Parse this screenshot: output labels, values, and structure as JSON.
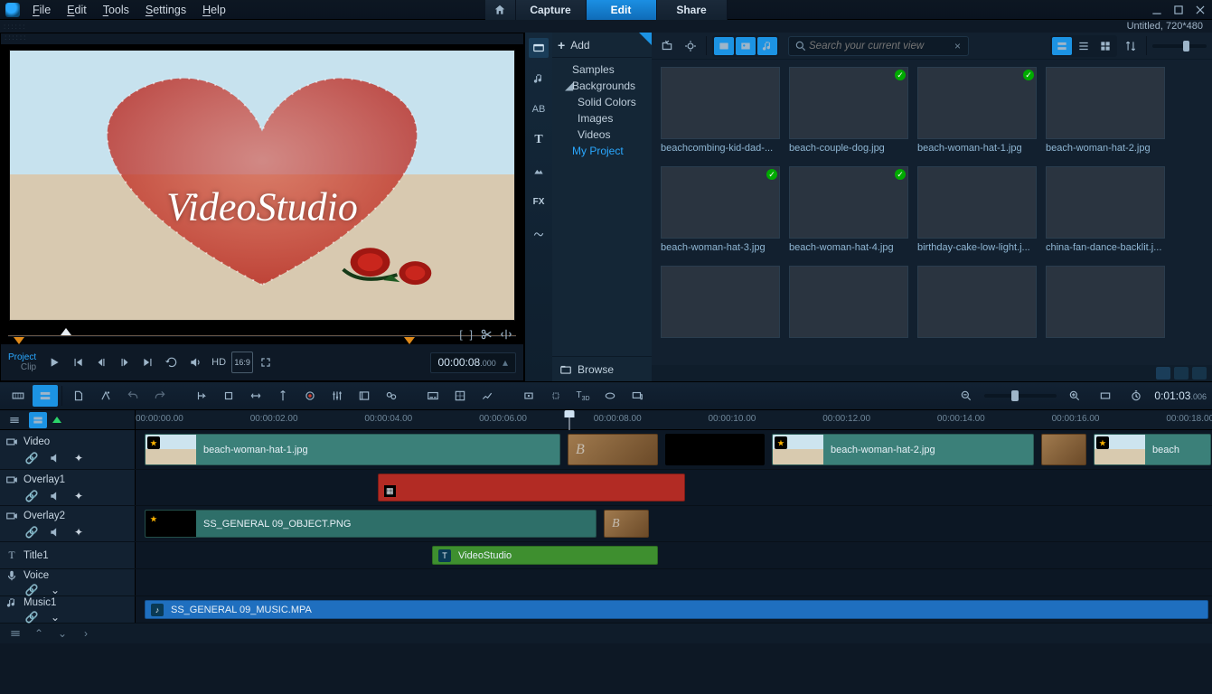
{
  "menus": {
    "file": "File",
    "edit": "Edit",
    "tools": "Tools",
    "settings": "Settings",
    "help": "Help"
  },
  "tabs": {
    "capture": "Capture",
    "edit": "Edit",
    "share": "Share"
  },
  "doc_title": "Untitled, 720*480",
  "preview": {
    "mode_project": "Project",
    "mode_clip": "Clip",
    "hd": "HD",
    "aspect": "16:9",
    "timecode": "00:00:08",
    "timecode_frames": ".000",
    "overlay_text": "VideoStudio"
  },
  "library": {
    "add": "Add",
    "tree": {
      "samples": "Samples",
      "backgrounds": "Backgrounds",
      "solid": "Solid Colors",
      "images": "Images",
      "videos": "Videos",
      "myproject": "My Project"
    },
    "browse": "Browse",
    "search_placeholder": "Search your current view",
    "items": [
      {
        "name": "beachcombing-kid-dad-...",
        "cls": "tg-beach",
        "chk": false
      },
      {
        "name": "beach-couple-dog.jpg",
        "cls": "tg-couple",
        "chk": true
      },
      {
        "name": "beach-woman-hat-1.jpg",
        "cls": "tg-hat",
        "chk": true
      },
      {
        "name": "beach-woman-hat-2.jpg",
        "cls": "tg-hat",
        "chk": false
      },
      {
        "name": "beach-woman-hat-3.jpg",
        "cls": "tg-hat",
        "chk": true
      },
      {
        "name": "beach-woman-hat-4.jpg",
        "cls": "tg-hat",
        "chk": true
      },
      {
        "name": "birthday-cake-low-light.j...",
        "cls": "tg-cake",
        "chk": false
      },
      {
        "name": "china-fan-dance-backlit.j...",
        "cls": "tg-fan",
        "chk": false
      },
      {
        "name": "",
        "cls": "tg-bus",
        "chk": false
      },
      {
        "name": "",
        "cls": "tg-selfie",
        "chk": false
      },
      {
        "name": "",
        "cls": "tg-sunset",
        "chk": false
      },
      {
        "name": "",
        "cls": "tg-night",
        "chk": false
      }
    ]
  },
  "timeline": {
    "timecode": "0:01:03",
    "timecode_frames": ".006",
    "ruler": [
      "00:00:00.00",
      "00:00:02.00",
      "00:00:04.00",
      "00:00:06.00",
      "00:00:08.00",
      "00:00:10.00",
      "00:00:12.00",
      "00:00:14.00",
      "00:00:16.00",
      "00:00:18.00"
    ],
    "tracks": {
      "video": "Video",
      "overlay1": "Overlay1",
      "overlay2": "Overlay2",
      "title1": "Title1",
      "voice": "Voice",
      "music1": "Music1"
    },
    "clips": {
      "v1": "beach-woman-hat-1.jpg",
      "v2": "beach-woman-hat-2.jpg",
      "v3": "beach",
      "ov2": "SS_GENERAL 09_OBJECT.PNG",
      "title": "VideoStudio",
      "music": "SS_GENERAL 09_MUSIC.MPA"
    }
  }
}
